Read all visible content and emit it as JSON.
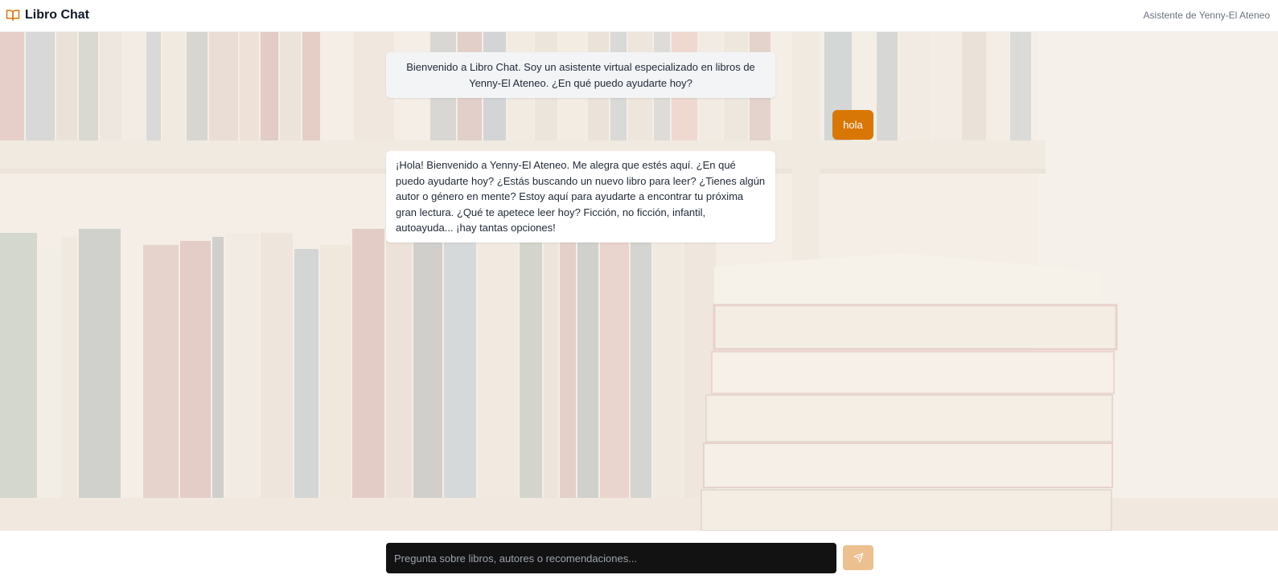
{
  "app": {
    "brand_icon": "open-book-icon",
    "title": "Libro Chat",
    "subtitle": "Asistente de Yenny-El Ateneo",
    "accent_color": "#d97706"
  },
  "messages": [
    {
      "role": "assistant",
      "text": "Bienvenido a Libro Chat. Soy un asistente virtual especializado en libros de Yenny-El Ateneo. ¿En qué puedo ayudarte hoy?"
    },
    {
      "role": "user",
      "text": "hola"
    },
    {
      "role": "assistant",
      "text": "¡Hola! Bienvenido a Yenny-El Ateneo. Me alegra que estés aquí. ¿En qué puedo ayudarte hoy? ¿Estás buscando un nuevo libro para leer? ¿Tienes algún autor o género en mente? Estoy aquí para ayudarte a encontrar tu próxima gran lectura. ¿Qué te apetece leer hoy? Ficción, no ficción, infantil, autoayuda... ¡hay tantas opciones!"
    }
  ],
  "composer": {
    "value": "",
    "placeholder": "Pregunta sobre libros, autores o recomendaciones...",
    "send_icon": "send-icon",
    "send_color": "#edc08f"
  }
}
